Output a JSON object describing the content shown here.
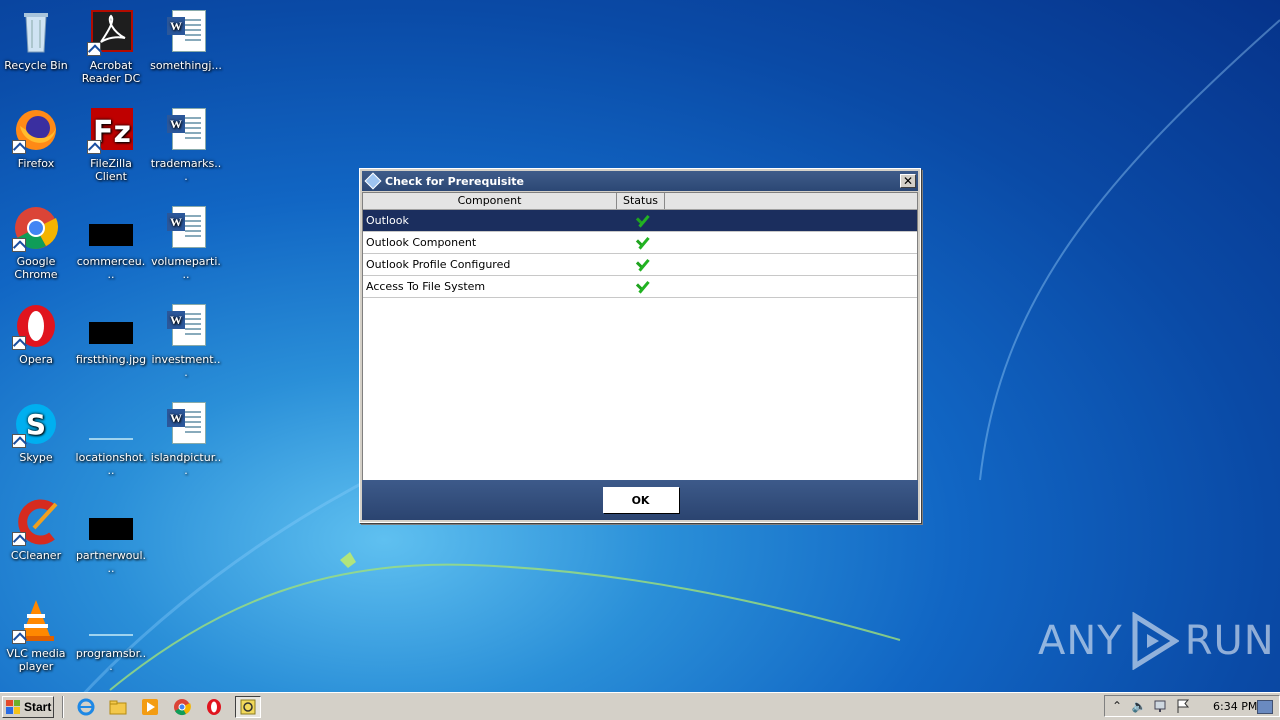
{
  "desktop": {
    "icons": [
      {
        "label": "Recycle Bin"
      },
      {
        "label": "Acrobat Reader DC"
      },
      {
        "label": "somethingj..."
      },
      {
        "label": "Firefox"
      },
      {
        "label": "FileZilla Client"
      },
      {
        "label": "trademarks..."
      },
      {
        "label": "Google Chrome"
      },
      {
        "label": "commerceu..."
      },
      {
        "label": "volumeparti..."
      },
      {
        "label": "Opera"
      },
      {
        "label": "firstthing.jpg"
      },
      {
        "label": "investment..."
      },
      {
        "label": "Skype"
      },
      {
        "label": "locationshot..."
      },
      {
        "label": "islandpictur..."
      },
      {
        "label": "CCleaner"
      },
      {
        "label": "partnerwoul..."
      },
      {
        "label": "VLC media player"
      },
      {
        "label": "programsbr..."
      }
    ]
  },
  "dialog": {
    "title": "Check for Prerequisite",
    "columns": [
      "Component",
      "Status"
    ],
    "rows": [
      {
        "component": "Outlook",
        "status": "check",
        "selected": true
      },
      {
        "component": "Outlook Component",
        "status": "check",
        "selected": false
      },
      {
        "component": "Outlook Profile Configured",
        "status": "check",
        "selected": false
      },
      {
        "component": "Access To File System",
        "status": "check",
        "selected": false
      }
    ],
    "ok_label": "OK",
    "colors": {
      "titlebar": "#2c4774",
      "selected_row": "#1b2e5e",
      "check": "#22b322"
    }
  },
  "taskbar": {
    "start_label": "Start",
    "pinned": [
      "ie-icon",
      "explorer-icon",
      "media-player-icon",
      "chrome-icon",
      "opera-icon",
      "prerequisite-app-icon"
    ],
    "clock": "6:34 PM"
  },
  "watermark": {
    "left": "ANY",
    "right": "RUN"
  }
}
